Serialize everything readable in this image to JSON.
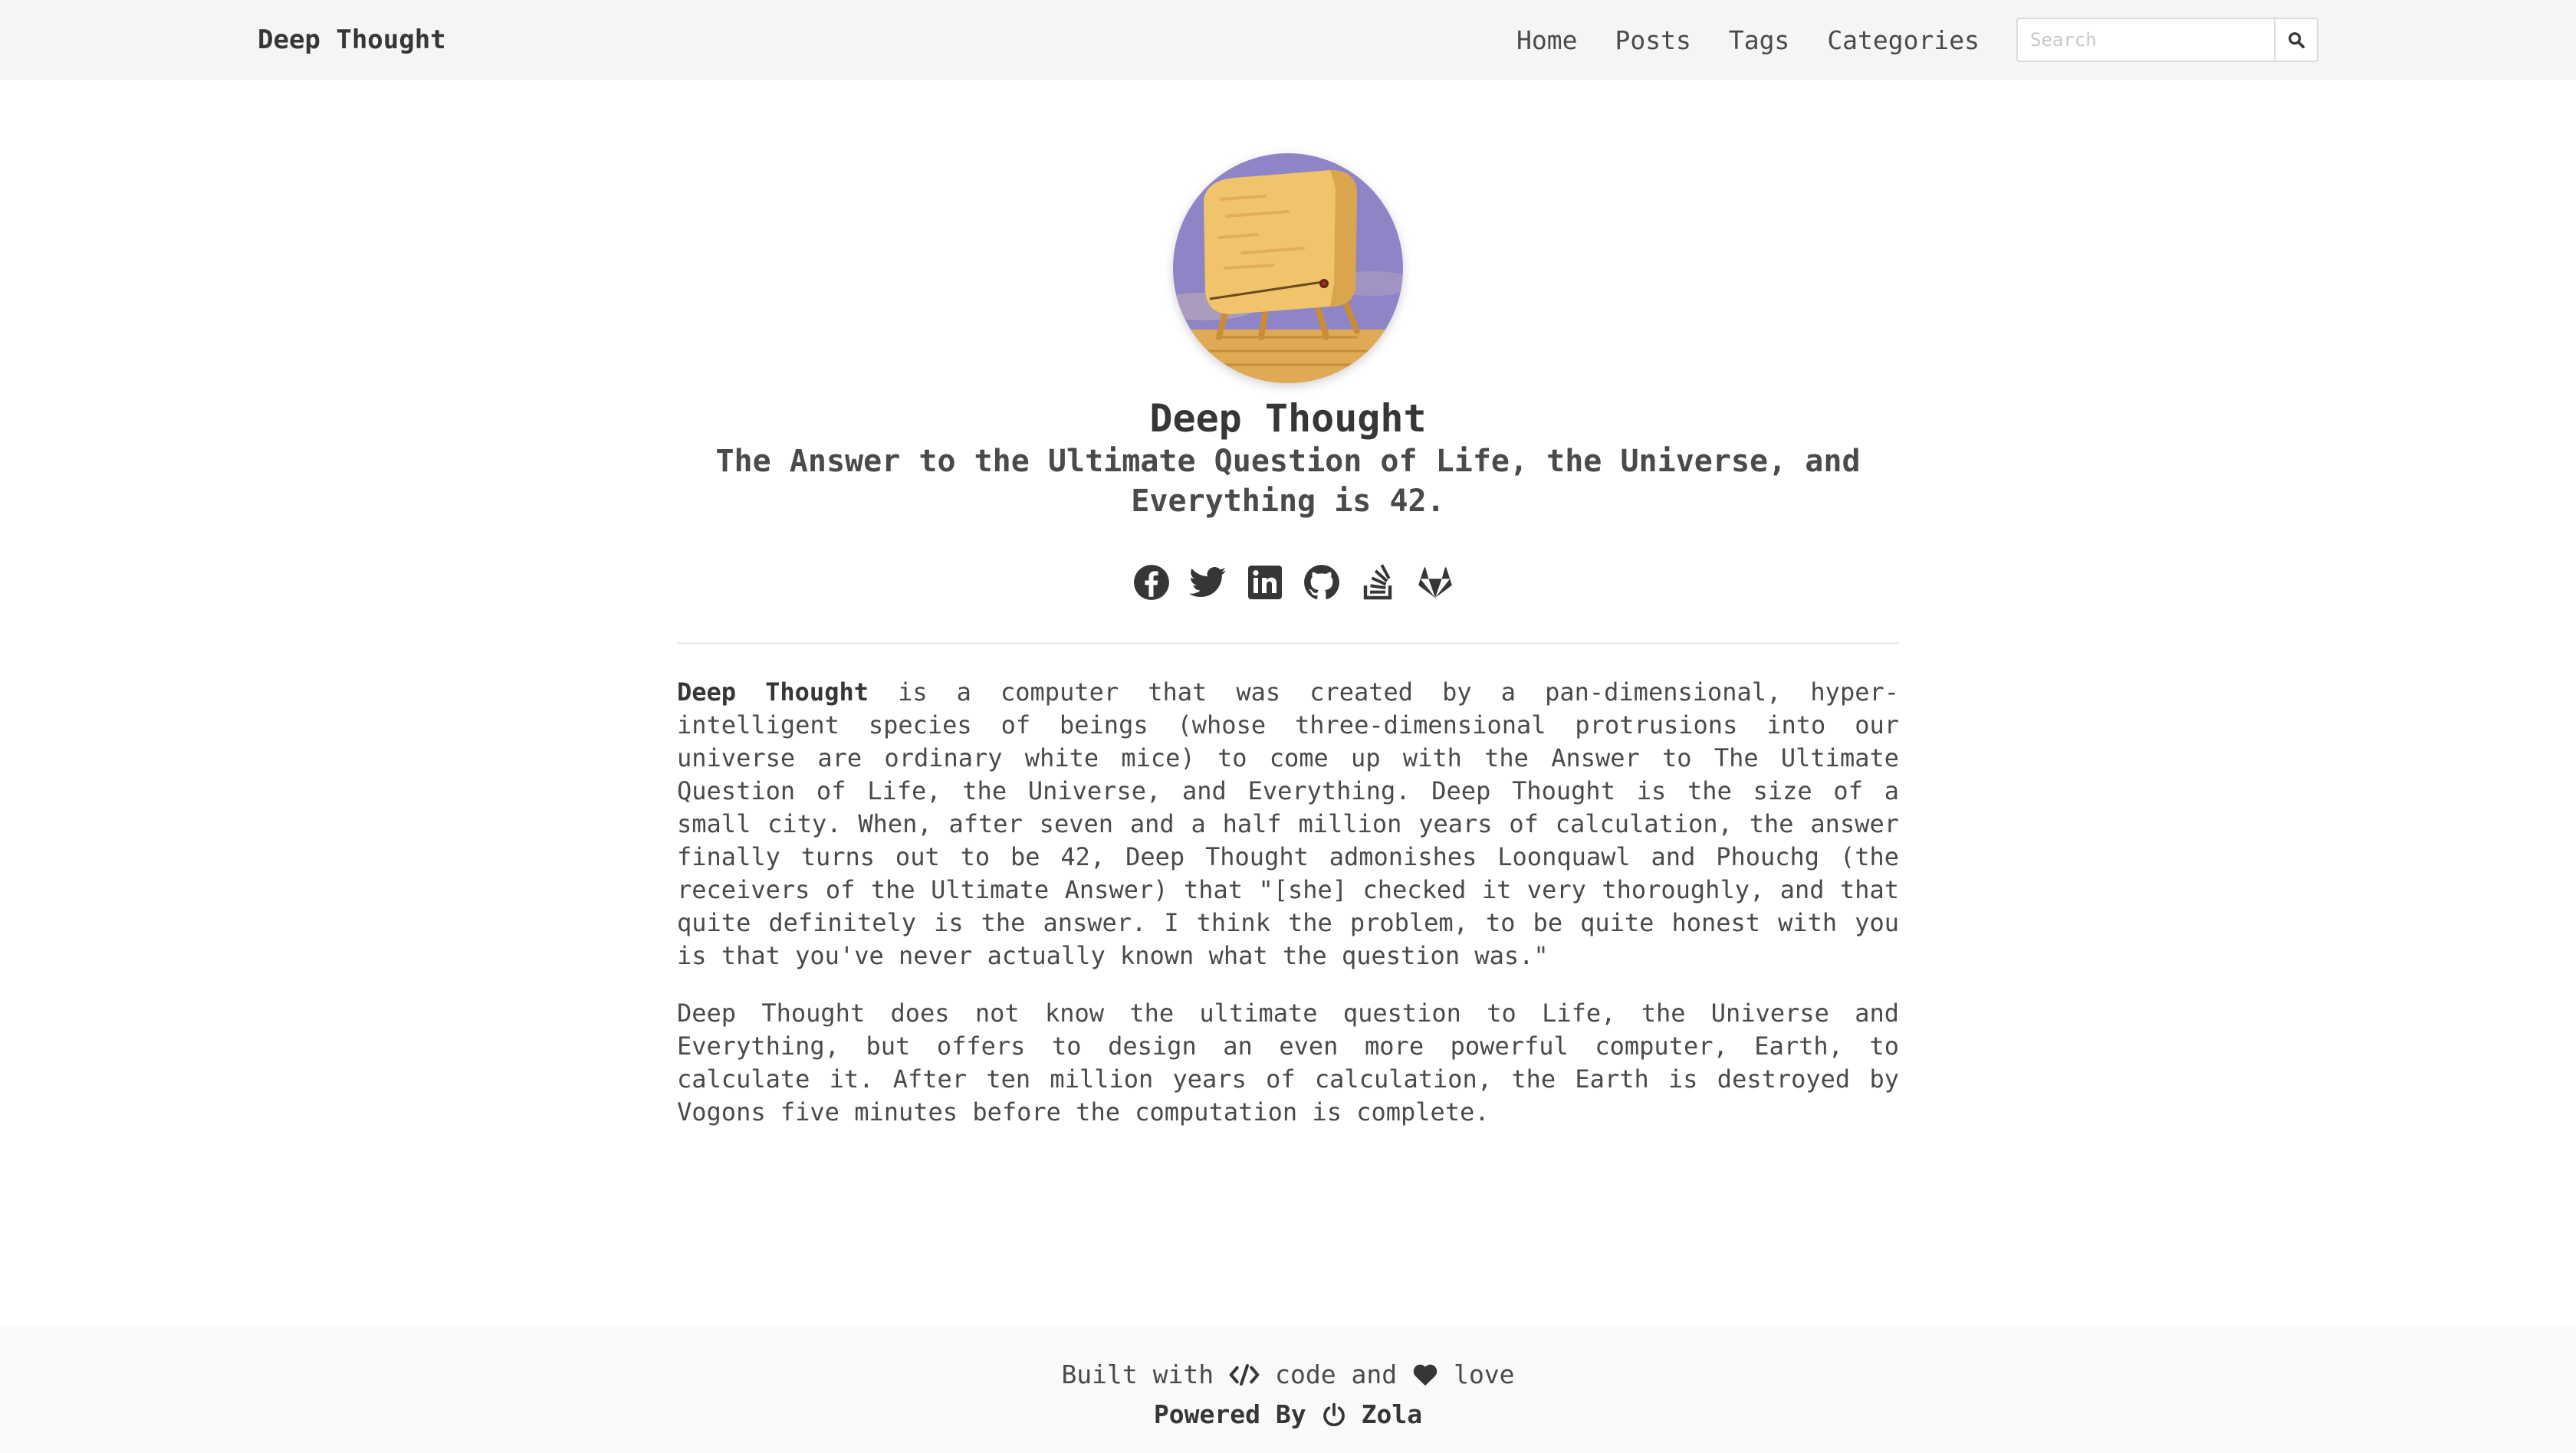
{
  "navbar": {
    "brand": "Deep Thought",
    "links": [
      "Home",
      "Posts",
      "Tags",
      "Categories"
    ],
    "search": {
      "placeholder": "Search",
      "value": ""
    },
    "search_button_icon": "search-icon"
  },
  "hero": {
    "avatar_icon": "deep-thought-computer-avatar",
    "title": "Deep Thought",
    "subtitle": "The Answer to the Ultimate Question of Life, the Universe, and Everything is 42.",
    "social_icons": [
      "facebook-icon",
      "twitter-icon",
      "linkedin-icon",
      "github-icon",
      "stackoverflow-icon",
      "gitlab-icon"
    ]
  },
  "content": {
    "para1_bold": "Deep Thought",
    "para1_rest": " is a computer that was created by a pan-dimensional, hyper-intelligent species of beings (whose three-dimensional protrusions into our universe are ordinary white mice) to come up with the Answer to The Ultimate Question of Life, the Universe, and Everything. Deep Thought is the size of a small city. When, after seven and a half million years of calculation, the answer finally turns out to be 42, Deep Thought admonishes Loonquawl and Phouchg (the receivers of the Ultimate Answer) that \"[she] checked it very thoroughly, and that quite definitely is the answer. I think the problem, to be quite honest with you is that you've never actually known what the question was.\"",
    "para2": "Deep Thought does not know the ultimate question to Life, the Universe and Everything, but offers to design an even more powerful computer, Earth, to calculate it. After ten million years of calculation, the Earth is destroyed by Vogons five minutes before the computation is complete."
  },
  "footer": {
    "built_with": "Built with",
    "code_icon": "code-icon",
    "code_and": "code and",
    "heart_icon": "heart-icon",
    "love": "love",
    "powered_by": "Powered By",
    "power_icon": "power-icon",
    "engine": "Zola"
  },
  "colors": {
    "navbar_bg": "#f5f5f5",
    "text": "#4a4a4a",
    "heading": "#363636",
    "avatar_bg": "#8e84c6",
    "footer_bg": "#fafafa"
  }
}
